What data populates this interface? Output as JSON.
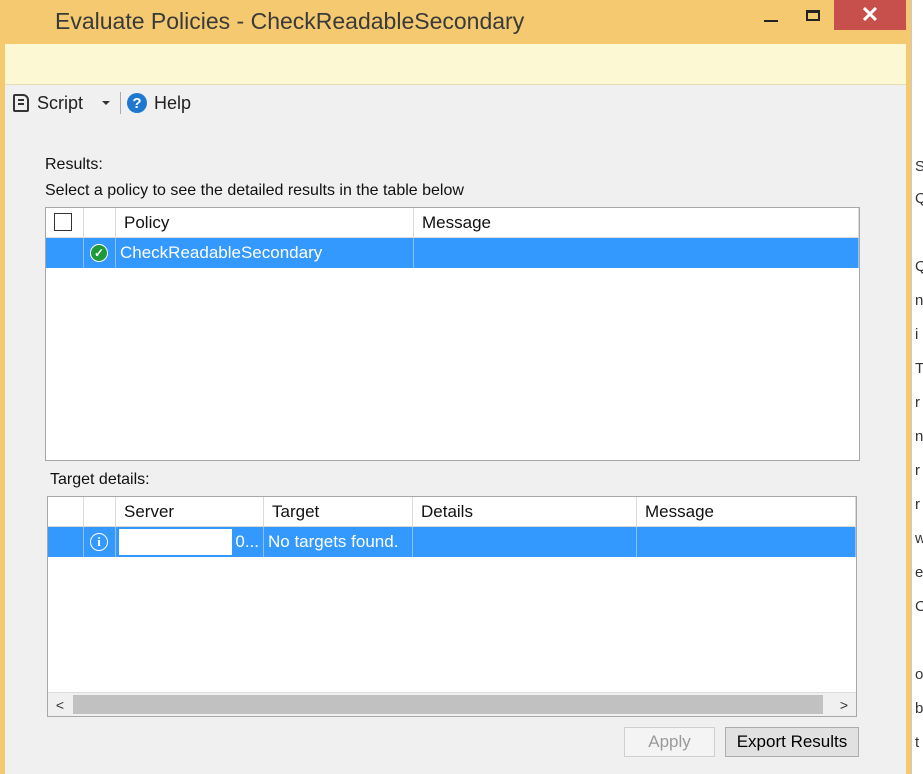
{
  "window": {
    "title": "Evaluate Policies - CheckReadableSecondary",
    "close_symbol": "✕"
  },
  "toolbar": {
    "script_label": "Script",
    "help_label": "Help",
    "help_symbol": "?"
  },
  "results": {
    "heading": "Results:",
    "instruction": "Select a policy to see the detailed results in the table below",
    "columns": [
      "",
      "",
      "Policy",
      "Message"
    ],
    "rows": [
      {
        "status": "success",
        "status_symbol": "✓",
        "policy": "CheckReadableSecondary",
        "message": ""
      }
    ]
  },
  "target_details": {
    "heading": "Target details:",
    "columns": [
      "",
      "",
      "Server",
      "Target",
      "Details",
      "Message"
    ],
    "rows": [
      {
        "status": "info",
        "status_symbol": "i",
        "server": "0...",
        "target": "No targets found.",
        "details": "",
        "message": ""
      }
    ]
  },
  "scrollbar": {
    "left_arrow": "<",
    "right_arrow": ">"
  },
  "buttons": {
    "apply_label": "Apply",
    "export_label": "Export Results"
  },
  "background_window_glyphs": [
    "S",
    "Q",
    "Q",
    "n",
    "i",
    "T",
    "r",
    "n",
    "r",
    "r",
    "w",
    "e",
    "C",
    "o",
    "b",
    "t"
  ],
  "colors": {
    "titlebar": "#f4c96f",
    "selection": "#3399ff",
    "close_button": "#c7504c",
    "success": "#1f9a3a"
  }
}
